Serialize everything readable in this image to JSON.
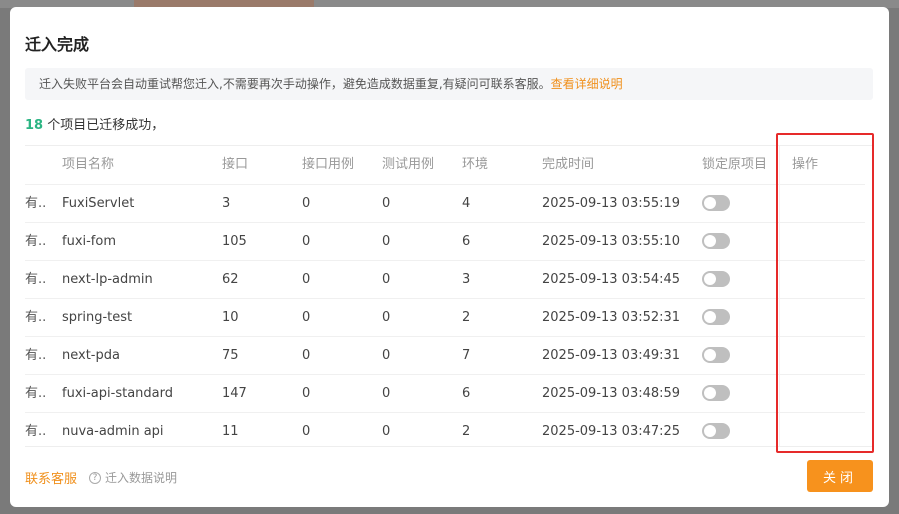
{
  "dialog": {
    "title": "迁入完成",
    "notice_text": "迁入失败平台会自动重试帮您迁入,不需要再次手动操作，避免造成数据重复,有疑问可联系客服。",
    "notice_link": "查看详细说明",
    "summary_count": "18",
    "summary_text": " 个项目已迁移成功，"
  },
  "table": {
    "headers": {
      "name": "项目名称",
      "api": "接口",
      "api_cases": "接口用例",
      "test_cases": "测试用例",
      "env": "环境",
      "time": "完成时间",
      "lock": "锁定原项目",
      "op": "操作"
    },
    "rows": [
      {
        "trunc": "有...",
        "name": "FuxiServlet",
        "api": "3",
        "api_cases": "0",
        "test_cases": "0",
        "env": "4",
        "time": "2025-09-13 03:55:19",
        "locked": false
      },
      {
        "trunc": "有...",
        "name": "fuxi-fom",
        "api": "105",
        "api_cases": "0",
        "test_cases": "0",
        "env": "6",
        "time": "2025-09-13 03:55:10",
        "locked": false
      },
      {
        "trunc": "有...",
        "name": "next-lp-admin",
        "api": "62",
        "api_cases": "0",
        "test_cases": "0",
        "env": "3",
        "time": "2025-09-13 03:54:45",
        "locked": false
      },
      {
        "trunc": "有...",
        "name": "spring-test",
        "api": "10",
        "api_cases": "0",
        "test_cases": "0",
        "env": "2",
        "time": "2025-09-13 03:52:31",
        "locked": false
      },
      {
        "trunc": "有...",
        "name": "next-pda",
        "api": "75",
        "api_cases": "0",
        "test_cases": "0",
        "env": "7",
        "time": "2025-09-13 03:49:31",
        "locked": false
      },
      {
        "trunc": "有...",
        "name": "fuxi-api-standard",
        "api": "147",
        "api_cases": "0",
        "test_cases": "0",
        "env": "6",
        "time": "2025-09-13 03:48:59",
        "locked": false
      },
      {
        "trunc": "有...",
        "name": "nuva-admin api",
        "api": "11",
        "api_cases": "0",
        "test_cases": "0",
        "env": "2",
        "time": "2025-09-13 03:47:25",
        "locked": false
      }
    ]
  },
  "footer": {
    "contact_label": "联系客服",
    "help_label": "迁入数据说明",
    "close_label": "关闭"
  },
  "colors": {
    "accent": "#f7921d",
    "success": "#2bb583",
    "highlight": "#e62a2a"
  },
  "icons": {
    "help": "question-circle-icon"
  }
}
